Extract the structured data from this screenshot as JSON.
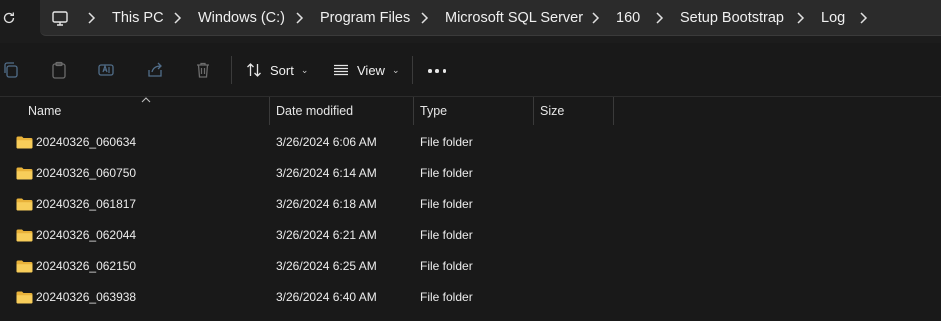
{
  "breadcrumb": [
    {
      "label": "This PC"
    },
    {
      "label": "Windows (C:)"
    },
    {
      "label": "Program Files"
    },
    {
      "label": "Microsoft SQL Server"
    },
    {
      "label": "160"
    },
    {
      "label": "Setup Bootstrap"
    },
    {
      "label": "Log"
    }
  ],
  "toolbar": {
    "sort_label": "Sort",
    "view_label": "View",
    "icons": [
      "copy-icon",
      "paste-icon",
      "rename-icon",
      "share-icon",
      "delete-icon",
      "sort-icon",
      "view-icon",
      "more-icon"
    ]
  },
  "columns": {
    "name": "Name",
    "date_modified": "Date modified",
    "type": "Type",
    "size": "Size"
  },
  "files": [
    {
      "name": "20240326_060634",
      "date": "3/26/2024 6:06 AM",
      "type": "File folder",
      "size": ""
    },
    {
      "name": "20240326_060750",
      "date": "3/26/2024 6:14 AM",
      "type": "File folder",
      "size": ""
    },
    {
      "name": "20240326_061817",
      "date": "3/26/2024 6:18 AM",
      "type": "File folder",
      "size": ""
    },
    {
      "name": "20240326_062044",
      "date": "3/26/2024 6:21 AM",
      "type": "File folder",
      "size": ""
    },
    {
      "name": "20240326_062150",
      "date": "3/26/2024 6:25 AM",
      "type": "File folder",
      "size": ""
    },
    {
      "name": "20240326_063938",
      "date": "3/26/2024 6:40 AM",
      "type": "File folder",
      "size": ""
    }
  ],
  "colors": {
    "background": "#191919",
    "address_bar": "#2b2b2b",
    "folder": "#f4c542"
  }
}
